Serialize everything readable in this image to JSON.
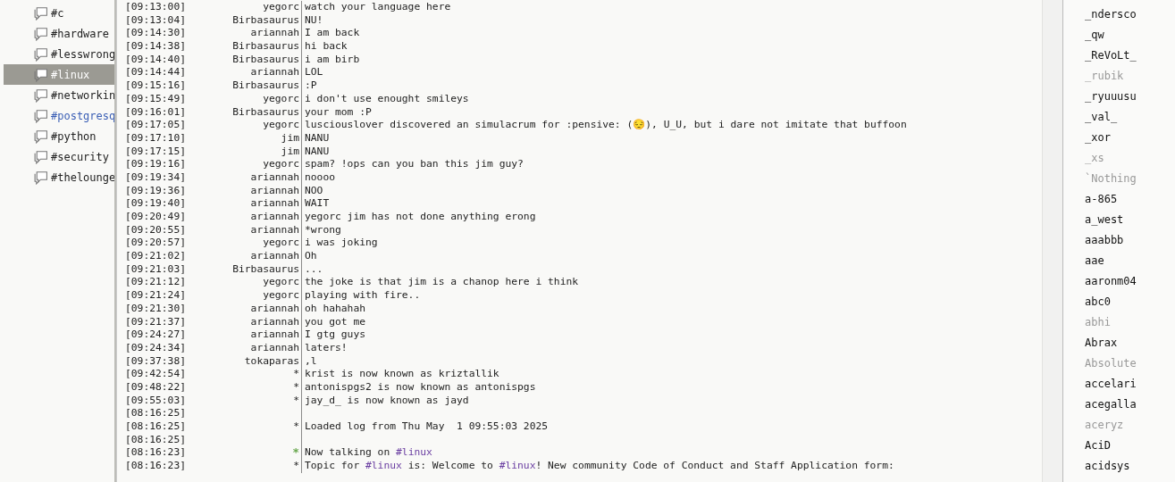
{
  "channels": [
    {
      "name": "#c",
      "selected": false,
      "highlighted": false
    },
    {
      "name": "#hardware",
      "selected": false,
      "highlighted": false
    },
    {
      "name": "#lesswrong",
      "selected": false,
      "highlighted": false
    },
    {
      "name": "#linux",
      "selected": true,
      "highlighted": false
    },
    {
      "name": "#networkin",
      "selected": false,
      "highlighted": false
    },
    {
      "name": "#postgresq",
      "selected": false,
      "highlighted": true
    },
    {
      "name": "#python",
      "selected": false,
      "highlighted": false
    },
    {
      "name": "#security",
      "selected": false,
      "highlighted": false
    },
    {
      "name": "#thelounge",
      "selected": false,
      "highlighted": false
    }
  ],
  "messages": [
    {
      "time": "[09:13:00]",
      "nick": "yegorc",
      "parts": [
        {
          "text": "watch your language here"
        }
      ]
    },
    {
      "time": "[09:13:04]",
      "nick": "Birbasaurus",
      "parts": [
        {
          "text": "NU!"
        }
      ]
    },
    {
      "time": "[09:14:30]",
      "nick": "ariannah",
      "parts": [
        {
          "text": "I am back"
        }
      ]
    },
    {
      "time": "[09:14:38]",
      "nick": "Birbasaurus",
      "parts": [
        {
          "text": "hi back"
        }
      ]
    },
    {
      "time": "[09:14:40]",
      "nick": "Birbasaurus",
      "parts": [
        {
          "text": "i am birb"
        }
      ]
    },
    {
      "time": "[09:14:44]",
      "nick": "ariannah",
      "parts": [
        {
          "text": "LOL"
        }
      ]
    },
    {
      "time": "[09:15:16]",
      "nick": "Birbasaurus",
      "parts": [
        {
          "text": ":P"
        }
      ]
    },
    {
      "time": "[09:15:49]",
      "nick": "yegorc",
      "parts": [
        {
          "text": "i don't use enought smileys"
        }
      ]
    },
    {
      "time": "[09:16:01]",
      "nick": "Birbasaurus",
      "parts": [
        {
          "text": "your mom :P"
        }
      ]
    },
    {
      "time": "[09:17:05]",
      "nick": "yegorc",
      "parts": [
        {
          "text": "lusciouslover discovered an simulacrum for :pensive: (😔), U_U, but i dare not imitate that buffoon"
        }
      ]
    },
    {
      "time": "[09:17:10]",
      "nick": "jim",
      "parts": [
        {
          "text": "NANU"
        }
      ]
    },
    {
      "time": "[09:17:15]",
      "nick": "jim",
      "parts": [
        {
          "text": "NANU"
        }
      ]
    },
    {
      "time": "[09:19:16]",
      "nick": "yegorc",
      "parts": [
        {
          "text": "spam? !ops can you ban this jim guy?"
        }
      ]
    },
    {
      "time": "[09:19:34]",
      "nick": "ariannah",
      "parts": [
        {
          "text": "noooo"
        }
      ]
    },
    {
      "time": "[09:19:36]",
      "nick": "ariannah",
      "parts": [
        {
          "text": "NOO"
        }
      ]
    },
    {
      "time": "[09:19:40]",
      "nick": "ariannah",
      "parts": [
        {
          "text": "WAIT"
        }
      ]
    },
    {
      "time": "[09:20:49]",
      "nick": "ariannah",
      "parts": [
        {
          "text": "yegorc jim has not done anything erong"
        }
      ]
    },
    {
      "time": "[09:20:55]",
      "nick": "ariannah",
      "parts": [
        {
          "text": "*wrong"
        }
      ]
    },
    {
      "time": "[09:20:57]",
      "nick": "yegorc",
      "parts": [
        {
          "text": "i was joking"
        }
      ]
    },
    {
      "time": "[09:21:02]",
      "nick": "ariannah",
      "parts": [
        {
          "text": "Oh"
        }
      ]
    },
    {
      "time": "[09:21:03]",
      "nick": "Birbasaurus",
      "parts": [
        {
          "text": "..."
        }
      ]
    },
    {
      "time": "[09:21:12]",
      "nick": "yegorc",
      "parts": [
        {
          "text": "the joke is that jim is a chanop here i think"
        }
      ]
    },
    {
      "time": "[09:21:24]",
      "nick": "yegorc",
      "parts": [
        {
          "text": "playing with fire.."
        }
      ]
    },
    {
      "time": "[09:21:30]",
      "nick": "ariannah",
      "parts": [
        {
          "text": "oh hahahah"
        }
      ]
    },
    {
      "time": "[09:21:37]",
      "nick": "ariannah",
      "parts": [
        {
          "text": "you got me"
        }
      ]
    },
    {
      "time": "[09:24:27]",
      "nick": "ariannah",
      "parts": [
        {
          "text": "I gtg guys"
        }
      ]
    },
    {
      "time": "[09:24:34]",
      "nick": "ariannah",
      "parts": [
        {
          "text": "laters!"
        }
      ]
    },
    {
      "time": "[09:37:38]",
      "nick": "tokaparas",
      "parts": [
        {
          "text": ",l"
        }
      ]
    },
    {
      "time": "[09:42:54]",
      "nick": "*",
      "parts": [
        {
          "text": "krist is now known as kriztallik"
        }
      ]
    },
    {
      "time": "[09:48:22]",
      "nick": "*",
      "parts": [
        {
          "text": "antonispgs2 is now known as antonispgs"
        }
      ]
    },
    {
      "time": "[09:55:03]",
      "nick": "*",
      "parts": [
        {
          "text": "jay_d_ is now known as jayd"
        }
      ]
    },
    {
      "time": "[08:16:25]"
    },
    {
      "time": "[08:16:25]",
      "nick": "*",
      "parts": [
        {
          "text": "Loaded log from Thu May  1 09:55:03 2025"
        }
      ]
    },
    {
      "time": "[08:16:25]"
    },
    {
      "time": "[08:16:23]",
      "nick": "*",
      "color": "#6aa84f",
      "parts": [
        {
          "text": "Now talking on "
        },
        {
          "text": "#linux",
          "kind": "channel"
        }
      ]
    },
    {
      "time": "[08:16:23]",
      "nick": "*",
      "parts": [
        {
          "text": "Topic for "
        },
        {
          "text": "#linux",
          "kind": "channel"
        },
        {
          "text": " is: Welcome to "
        },
        {
          "text": "#linux",
          "kind": "channel"
        },
        {
          "text": "! New community Code of Conduct and Staff Application form:"
        }
      ]
    }
  ],
  "users": [
    {
      "nick": "_ndersco",
      "away": false
    },
    {
      "nick": "_qw",
      "away": false
    },
    {
      "nick": "_ReVoLt_",
      "away": false
    },
    {
      "nick": "_rubik",
      "away": true
    },
    {
      "nick": "_ryuuusu",
      "away": false
    },
    {
      "nick": "_val_",
      "away": false
    },
    {
      "nick": "_xor",
      "away": false
    },
    {
      "nick": "_xs",
      "away": true
    },
    {
      "nick": "`Nothing",
      "away": true
    },
    {
      "nick": "a-865",
      "away": false
    },
    {
      "nick": "a_west",
      "away": false
    },
    {
      "nick": "aaabbb",
      "away": false
    },
    {
      "nick": "aae",
      "away": false
    },
    {
      "nick": "aaronm04",
      "away": false
    },
    {
      "nick": "abc0",
      "away": false
    },
    {
      "nick": "abhi",
      "away": true
    },
    {
      "nick": "Abrax",
      "away": false
    },
    {
      "nick": "Absolute",
      "away": true
    },
    {
      "nick": "accelari",
      "away": false
    },
    {
      "nick": "acegalla",
      "away": false
    },
    {
      "nick": "aceryz",
      "away": true
    },
    {
      "nick": "AciD",
      "away": false
    },
    {
      "nick": "acidsys",
      "away": false
    }
  ]
}
